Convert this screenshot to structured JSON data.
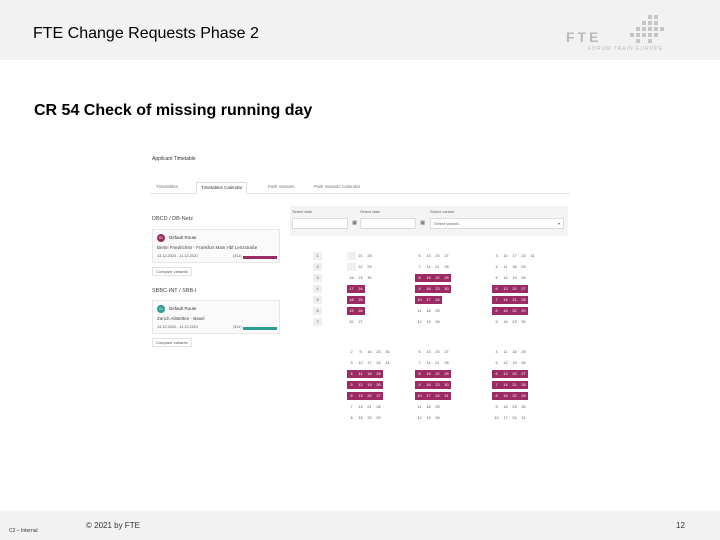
{
  "header": {
    "title": "FTE Change Requests Phase 2",
    "logo_text": "FTE",
    "logo_subtitle": "FORUM TRAIN EUROPE"
  },
  "slide": {
    "heading": "CR 54 Check of missing running day"
  },
  "app": {
    "title": "Applicant Timetable",
    "tabs": [
      "Timetables",
      "Timetables Calendar",
      "Path Variants",
      "Path Variants Calendar"
    ],
    "active_tab": "Timetables Calendar",
    "companies": [
      {
        "name": "DBCD / DB-Netz",
        "variant": "Default Route",
        "variant_no": "01",
        "route": "Berlin Friedrichstr - Frankfurt Main Hbf Lenzstraße",
        "dates": "13.12.2020 - 11.12.2021",
        "days": "(311)",
        "compare": "Compare variants"
      },
      {
        "name": "SBBC-INT / SBB-I",
        "variant": "Default Route",
        "variant_no": "01",
        "route": "Zürich Altstetten - Basel",
        "dates": "13.12.2020 - 11.12.2021",
        "days": "(311)",
        "compare": "Compare variants"
      }
    ],
    "filters": {
      "from_label": "Select date",
      "to_label": "Select date",
      "variant_label": "Select variant",
      "variant_placeholder": "Select variant..."
    },
    "colors": {
      "accent": "#9c2a63",
      "teal": "#2a9c94",
      "empty": "#efefef"
    }
  },
  "calendar_top": {
    "weekdays": [
      "1",
      "2",
      "3",
      "4",
      "5",
      "6",
      "7"
    ],
    "m1": [
      "16",
      "17",
      "18",
      "19",
      "20",
      "21",
      "22",
      "23",
      "24",
      "25",
      "26",
      "27",
      "28",
      "29",
      "30"
    ],
    "m2": [
      "6",
      "7",
      "8",
      "9",
      "10",
      "11",
      "12",
      "13",
      "14",
      "15",
      "16",
      "17",
      "18",
      "19",
      "20",
      "21",
      "22",
      "23",
      "24",
      "25",
      "26",
      "27",
      "28",
      "29",
      "30"
    ],
    "m3": [
      "3",
      "4",
      "5",
      "6",
      "7",
      "8",
      "9",
      "10",
      "11",
      "12",
      "13",
      "14",
      "15",
      "16",
      "17",
      "18",
      "19",
      "20",
      "21",
      "22",
      "23",
      "24",
      "25",
      "26",
      "27",
      "28",
      "29",
      "30",
      "31"
    ],
    "m4": [
      "3",
      "4",
      "5",
      "6",
      "7",
      "8",
      "9",
      "10",
      "11",
      "12",
      "13",
      "14",
      "15",
      "16",
      "17",
      "18",
      "19",
      "20",
      "21",
      "22",
      "23",
      "24",
      "25",
      "26",
      "27",
      "28",
      "29",
      "30",
      "31"
    ]
  },
  "calendar_bottom": {
    "m1": [
      "2",
      "3",
      "4",
      "5",
      "6",
      "7",
      "8",
      "9",
      "10",
      "11",
      "12",
      "13",
      "14",
      "15",
      "16",
      "17",
      "18",
      "19",
      "20",
      "21",
      "22",
      "23",
      "24",
      "25",
      "26",
      "27",
      "28",
      "29",
      "30",
      "31"
    ],
    "m2": [
      "6",
      "7",
      "8",
      "9",
      "10",
      "11",
      "12",
      "13",
      "14",
      "15",
      "16",
      "17",
      "18",
      "19",
      "20",
      "21",
      "22",
      "23",
      "24",
      "25",
      "26",
      "27",
      "28",
      "29",
      "30",
      "31"
    ],
    "m3": [
      "4",
      "5",
      "6",
      "7",
      "8",
      "9",
      "10",
      "11",
      "12",
      "13",
      "14",
      "15",
      "16",
      "17",
      "18",
      "19",
      "20",
      "21",
      "22",
      "23",
      "24",
      "25",
      "26",
      "27",
      "28",
      "29",
      "30",
      "31"
    ]
  },
  "footer": {
    "classification": "C2 – Internal",
    "copyright": "© 2021 by FTE",
    "page": "12"
  }
}
